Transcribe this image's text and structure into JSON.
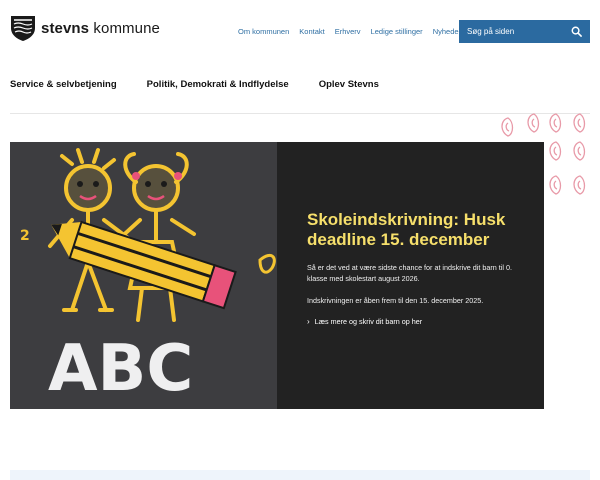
{
  "brand": {
    "name_bold": "stevns",
    "name_rest": " kommune"
  },
  "top_nav": [
    "Om kommunen",
    "Kontakt",
    "Erhverv",
    "Ledige stillinger",
    "Nyheder"
  ],
  "search": {
    "placeholder": "Søg på siden",
    "icon": "search-icon"
  },
  "main_nav": [
    "Service & selvbetjening",
    "Politik, Demokrati & Indflydelse",
    "Oplev Stevns"
  ],
  "hero": {
    "title": "Skoleindskrivning: Husk deadline 15. december",
    "paragraph1": "Så er det ved at være sidste chance for at indskrive dit barn til 0. klasse med skolestart august 2026.",
    "paragraph2": "Indskrivningen er åben frem til den 15. december 2025.",
    "link": "Læs mere og skriv dit barn op her",
    "image_text": "ABC",
    "image_digit": "2"
  },
  "colors": {
    "accent": "#2b6aa0",
    "hero_title": "#f6df6b",
    "hero_bg": "#222222",
    "link": "#2f6fa3"
  }
}
